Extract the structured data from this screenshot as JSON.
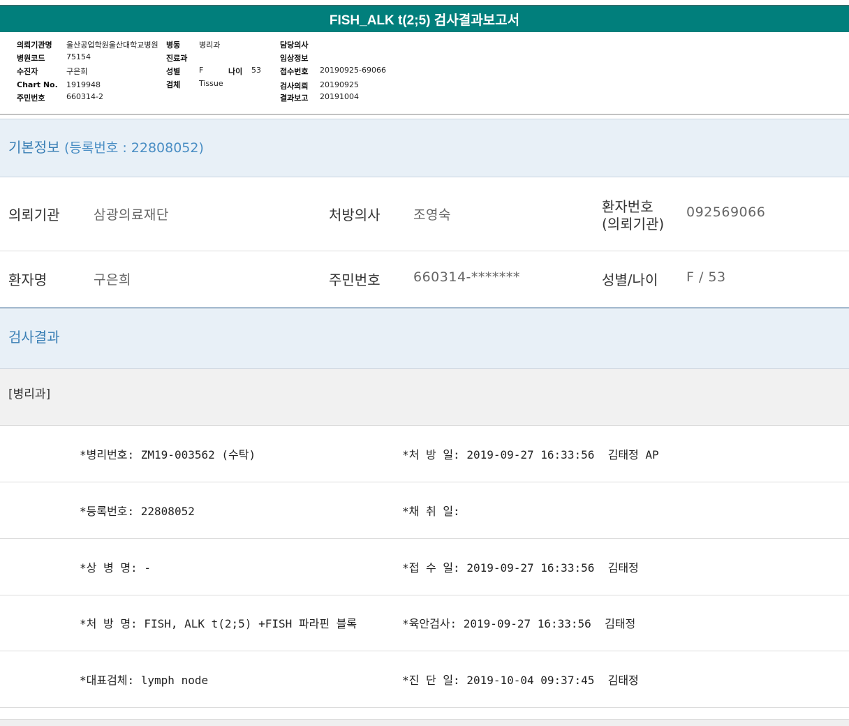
{
  "title": "FISH_ALK t(2;5) 검사결과보고서",
  "header": {
    "col1": [
      {
        "label": "의뢰기관명",
        "value": "울산공업학원울산대학교병원"
      },
      {
        "label": "병원코드",
        "value": "75154"
      },
      {
        "label": "수진자",
        "value": "구은희"
      },
      {
        "label": "Chart No.",
        "value": "1919948"
      },
      {
        "label": "주민번호",
        "value": "660314-2"
      }
    ],
    "col2": [
      {
        "label": "병동",
        "value": "병리과"
      },
      {
        "label": "진료과",
        "value": ""
      },
      {
        "label": "성별",
        "value": "F"
      },
      {
        "label": "검체",
        "value": "Tissue"
      }
    ],
    "age": {
      "label": "나이",
      "value": "53"
    },
    "col3": [
      {
        "label": "담당의사",
        "value": ""
      },
      {
        "label": "임상정보",
        "value": ""
      },
      {
        "label": "접수번호",
        "value": "20190925-69066"
      },
      {
        "label": "검사의뢰",
        "value": "20190925"
      },
      {
        "label": "결과보고",
        "value": "20191004"
      }
    ]
  },
  "basic_info": {
    "heading": "기본정보",
    "reg_label": "(등록번호 : 22808052)",
    "rows": [
      [
        {
          "label": "의뢰기관",
          "value": "삼광의료재단"
        },
        {
          "label": "처방의사",
          "value": "조영숙"
        },
        {
          "label": "환자번호",
          "label2": "(의뢰기관)",
          "value": "092569066"
        }
      ],
      [
        {
          "label": "환자명",
          "value": "구은희"
        },
        {
          "label": "주민번호",
          "value": "660314-*******"
        },
        {
          "label": "성별/나이",
          "value": "F / 53"
        }
      ]
    ]
  },
  "results": {
    "heading": "검사결과",
    "department": "[병리과]",
    "rows": [
      {
        "left": "*병리번호: ZM19-003562 (수탁)",
        "right": "*처 방 일: 2019-09-27 16:33:56  김태정 AP"
      },
      {
        "left": "*등록번호: 22808052",
        "right": "*채 취 일:"
      },
      {
        "left": "*상 병 명: -",
        "right": "*접 수 일: 2019-09-27 16:33:56  김태정"
      },
      {
        "left": "*처 방 명: FISH, ALK t(2;5) +FISH 파라핀 블록",
        "right": "*육안검사: 2019-09-27 16:33:56  김태정"
      },
      {
        "left": "*대표검체: lymph node",
        "right": "*진 단 일: 2019-10-04 09:37:45  김태정"
      }
    ]
  }
}
